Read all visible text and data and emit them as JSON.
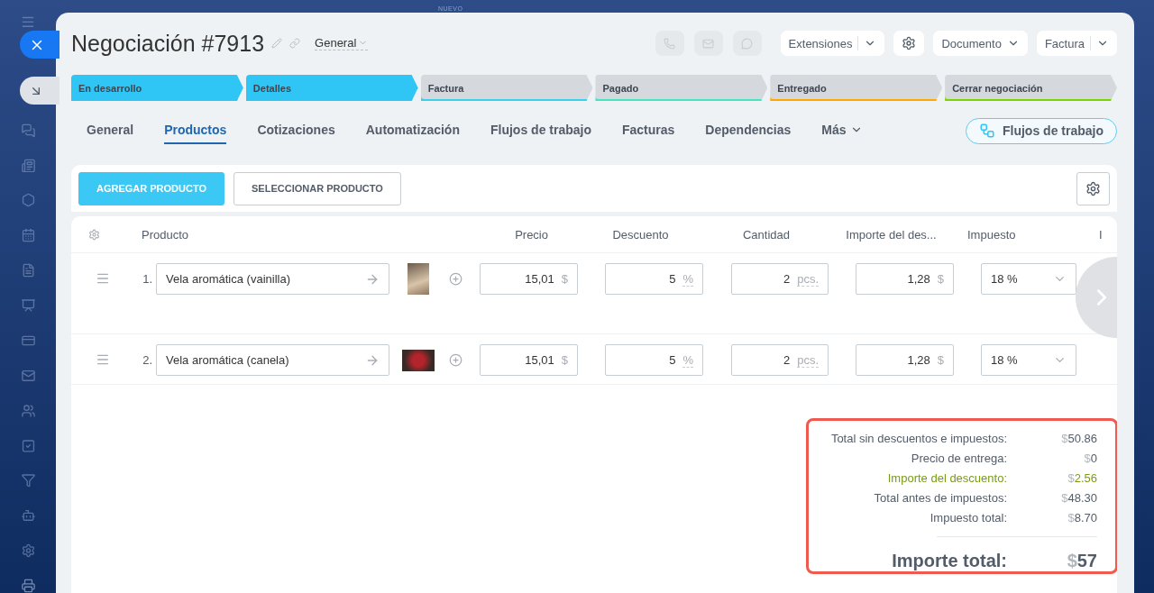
{
  "background": {
    "label": "NUEVO"
  },
  "header": {
    "title": "Negociación #7913",
    "pipeline": "General",
    "menus": [
      {
        "kind": "split",
        "label": "Extensiones"
      },
      {
        "kind": "settings"
      },
      {
        "kind": "dropdown",
        "label": "Documento"
      },
      {
        "kind": "split",
        "label": "Factura"
      }
    ]
  },
  "stages": [
    {
      "label": "En desarrollo",
      "reached": true,
      "color": "#2fc6f6"
    },
    {
      "label": "Detalles",
      "reached": true,
      "color": "#2fc6f6"
    },
    {
      "label": "Factura",
      "reached": false,
      "color": "#39d0e9"
    },
    {
      "label": "Pagado",
      "reached": false,
      "color": "#47e4c2"
    },
    {
      "label": "Entregado",
      "reached": false,
      "color": "#ffa900"
    },
    {
      "label": "Cerrar negociación",
      "reached": false,
      "color": "#7bd500"
    }
  ],
  "tabs": [
    {
      "label": "General",
      "selected": false
    },
    {
      "label": "Productos",
      "selected": true
    },
    {
      "label": "Cotizaciones",
      "selected": false
    },
    {
      "label": "Automatización",
      "selected": false
    },
    {
      "label": "Flujos de trabajo",
      "selected": false
    },
    {
      "label": "Facturas",
      "selected": false
    },
    {
      "label": "Dependencias",
      "selected": false
    },
    {
      "label": "Más",
      "selected": false
    }
  ],
  "flows_button": {
    "label": "Flujos de trabajo"
  },
  "toolbar": {
    "buttons": [
      {
        "kind": "primary",
        "label": "AGREGAR PRODUCTO"
      },
      {
        "kind": "secondary",
        "label": "SELECCIONAR PRODUCTO"
      }
    ]
  },
  "table": {
    "columns": [
      "Producto",
      "Precio",
      "Descuento",
      "Cantidad",
      "Importe del des...",
      "Impuesto",
      "I"
    ],
    "rows": [
      {
        "number": "1.",
        "product": "Vela aromática (vainilla)",
        "price": "15,01",
        "price_currency": "$",
        "discount": "5",
        "discount_unit": "%",
        "quantity": "2",
        "quantity_unit": "pcs.",
        "discount_amount": "1,28",
        "discount_currency": "$",
        "tax": "18 %"
      },
      {
        "number": "2.",
        "product": "Vela aromática (canela)",
        "price": "15,01",
        "price_currency": "$",
        "discount": "5",
        "discount_unit": "%",
        "quantity": "2",
        "quantity_unit": "pcs.",
        "discount_amount": "1,28",
        "discount_currency": "$",
        "tax": "18 %"
      }
    ]
  },
  "totals": {
    "rows": [
      {
        "kind": "normal",
        "label": "Total sin descuentos e impuestos:",
        "currency": "$",
        "value": "50.86"
      },
      {
        "kind": "normal",
        "label": "Precio de entrega:",
        "currency": "$",
        "value": "0"
      },
      {
        "kind": "discount",
        "label": "Importe del descuento:",
        "currency": "$",
        "value": "2.56"
      },
      {
        "kind": "normal",
        "label": "Total antes de impuestos:",
        "currency": "$",
        "value": "48.30"
      },
      {
        "kind": "normal",
        "label": "Impuesto total:",
        "currency": "$",
        "value": "8.70"
      }
    ],
    "grand_total": {
      "label": "Importe total:",
      "currency": "$",
      "value": "57"
    }
  }
}
